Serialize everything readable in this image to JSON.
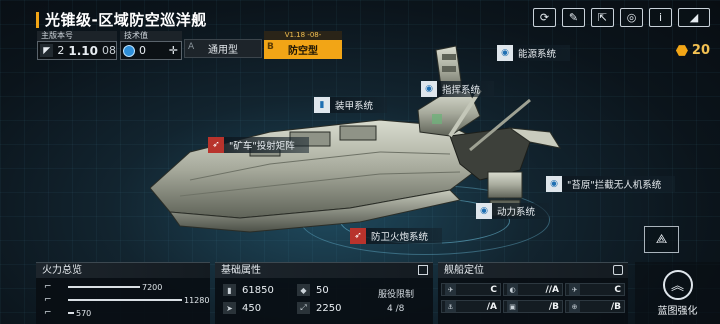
{
  "header": {
    "title": "光锥级-区域防空巡洋舰"
  },
  "top_icons": [
    {
      "name": "refresh-icon",
      "glyph": "⟳"
    },
    {
      "name": "paint-icon",
      "glyph": "✎"
    },
    {
      "name": "share-icon",
      "glyph": "⇱"
    },
    {
      "name": "camera-icon",
      "glyph": "◎"
    },
    {
      "name": "info-icon",
      "glyph": "i"
    },
    {
      "name": "back-icon",
      "glyph": "◢"
    }
  ],
  "version": {
    "label": "主版本号",
    "major": "2",
    "number": "1.10",
    "minor": "08"
  },
  "tech": {
    "label": "技术值",
    "value": "0"
  },
  "types": {
    "general": {
      "letter": "A",
      "label": "通用型"
    },
    "anti_air": {
      "letter": "B",
      "label": "防空型",
      "version": "V1.18 -08-"
    }
  },
  "energy": {
    "value": "20",
    "color": "#f2a516"
  },
  "systems": {
    "power": "能源系统",
    "command": "指挥系统",
    "armor": "装甲系统",
    "mine": "\"矿车\"投射矩阵",
    "drone": "\"苔原\"拦截无人机系统",
    "propulsion": "动力系统",
    "cannon": "防卫火炮系统"
  },
  "firepower": {
    "title": "火力总览",
    "rows": [
      {
        "value": 7200,
        "fraction": 0.6
      },
      {
        "value": 11280,
        "fraction": 0.95
      },
      {
        "value": 570,
        "fraction": 0.05
      }
    ],
    "row_labels": [
      "7200",
      "11280",
      "570"
    ]
  },
  "base_stats": {
    "title": "基础属性",
    "hp": "61850",
    "armor": "50",
    "speed": "450",
    "range": "2250",
    "service_label": "服役限制",
    "service_value": "4 /8"
  },
  "positioning": {
    "title": "舰船定位",
    "cells": [
      {
        "icon": "✈",
        "grade": "C"
      },
      {
        "icon": "◐",
        "grade": "//A"
      },
      {
        "icon": "✈",
        "grade": "C"
      },
      {
        "icon": "⚓",
        "grade": "/A"
      },
      {
        "icon": "▣",
        "grade": "/B"
      },
      {
        "icon": "⊕",
        "grade": "/B"
      }
    ]
  },
  "blueprint": {
    "label": "蓝图强化"
  }
}
